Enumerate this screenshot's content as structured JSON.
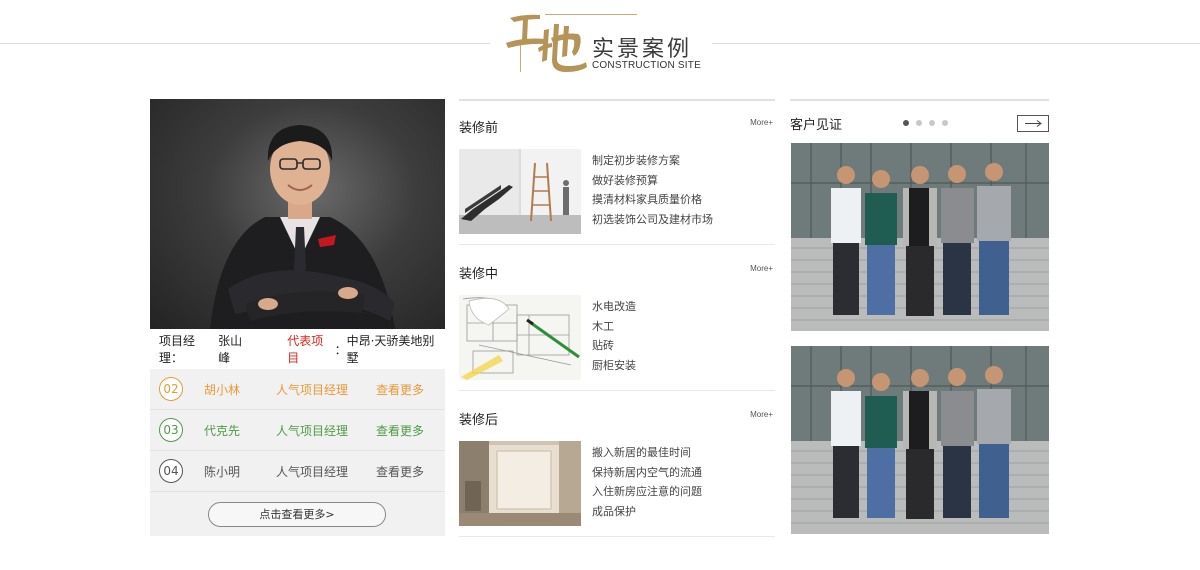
{
  "header": {
    "logo_calligraphy": "工地",
    "title_cn": "实景案例",
    "title_en": "CONSTRUCTION SITE"
  },
  "featured": {
    "manager_label": "项目经理：",
    "manager_name": "张山峰",
    "project_label": "代表项目",
    "project_sep": "：",
    "project_name": "中昂·天骄美地别墅"
  },
  "staff": [
    {
      "num": "02",
      "name": "胡小林",
      "title": "人气项目经理",
      "more": "查看更多",
      "color": "orange"
    },
    {
      "num": "03",
      "name": "代克先",
      "title": "人气项目经理",
      "more": "查看更多",
      "color": "green"
    },
    {
      "num": "04",
      "name": "陈小明",
      "title": "人气项目经理",
      "more": "查看更多",
      "color": "gray"
    }
  ],
  "staff_more_button": "点击查看更多>",
  "sections": [
    {
      "title": "装修前",
      "more": "More+",
      "items": [
        "制定初步装修方案",
        "做好装修预算",
        "摸清材料家具质量价格",
        "初选装饰公司及建材市场"
      ]
    },
    {
      "title": "装修中",
      "more": "More+",
      "items": [
        "水电改造",
        "木工",
        "贴砖",
        "厨柜安装"
      ]
    },
    {
      "title": "装修后",
      "more": "More+",
      "items": [
        "搬入新居的最佳时间",
        "保持新居内空气的流通",
        "入住新房应注意的问题",
        "成品保护"
      ]
    }
  ],
  "testimonials": {
    "title": "客户见证",
    "slide_count": 4,
    "active_slide": 1,
    "icons": {
      "next": "arrow-right-icon"
    }
  },
  "colors": {
    "accent_red": "#d6261c",
    "orange": "#e89a36",
    "green": "#4f9a47",
    "gold": "#b59457"
  }
}
